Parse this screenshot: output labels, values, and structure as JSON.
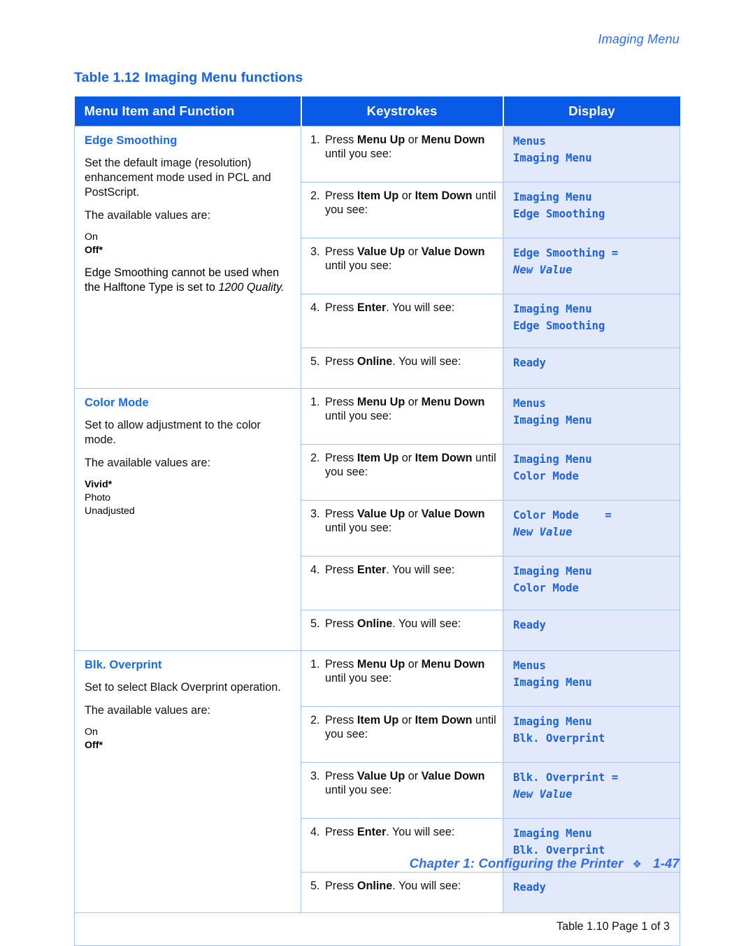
{
  "running_head": "Imaging Menu",
  "table_caption": {
    "label": "Table 1.12",
    "title": "Imaging Menu functions"
  },
  "columns": {
    "function": "Menu Item and Function",
    "keystrokes": "Keystrokes",
    "display": "Display"
  },
  "sections": [
    {
      "title": "Edge Smoothing",
      "description_1": "Set the default image (resolution) enhancement mode used in PCL and PostScript.",
      "description_2": "The available values are:",
      "values": [
        {
          "text": "On",
          "default": false
        },
        {
          "text": "Off*",
          "default": true
        }
      ],
      "note_plain": "Edge Smoothing cannot be used when the Halftone Type is set to ",
      "note_italic": "1200 Quality.",
      "steps": [
        {
          "number": "1.",
          "text_parts": [
            "Press ",
            "Menu Up",
            " or ",
            "Menu Down",
            " until you see:"
          ],
          "display_line_1": "Menus",
          "display_line_2": "Imaging Menu",
          "display_line_2_italic": false
        },
        {
          "number": "2.",
          "text_parts": [
            "Press ",
            "Item Up",
            " or ",
            "Item Down",
            " until you see:"
          ],
          "display_line_1": "Imaging Menu",
          "display_line_2": "Edge Smoothing",
          "display_line_2_italic": false
        },
        {
          "number": "3.",
          "text_parts": [
            "Press ",
            "Value Up",
            " or ",
            "Value Down",
            " until you see:"
          ],
          "display_line_1": "Edge Smoothing =",
          "display_line_2": "New Value",
          "display_line_2_italic": true
        },
        {
          "number": "4.",
          "text_parts": [
            "Press ",
            "Enter",
            ". You will see:",
            "",
            ""
          ],
          "display_line_1": "Imaging Menu",
          "display_line_2": "Edge Smoothing",
          "display_line_2_italic": false
        },
        {
          "number": "5.",
          "text_parts": [
            "Press ",
            "Online",
            ". You will see:",
            "",
            ""
          ],
          "display_line_1": "Ready",
          "display_line_2": "",
          "display_line_2_italic": false
        }
      ]
    },
    {
      "title": "Color Mode",
      "description_1": "Set to allow adjustment to the color mode.",
      "description_2": "The available values are:",
      "values": [
        {
          "text": "Vivid*",
          "default": true
        },
        {
          "text": "Photo",
          "default": false
        },
        {
          "text": "Unadjusted",
          "default": false
        }
      ],
      "note_plain": "",
      "note_italic": "",
      "steps": [
        {
          "number": "1.",
          "text_parts": [
            "Press ",
            "Menu Up",
            " or ",
            "Menu Down",
            " until you see:"
          ],
          "display_line_1": "Menus",
          "display_line_2": "Imaging Menu",
          "display_line_2_italic": false
        },
        {
          "number": "2.",
          "text_parts": [
            "Press ",
            "Item Up",
            " or ",
            "Item Down",
            " until you see:"
          ],
          "display_line_1": "Imaging Menu",
          "display_line_2": "Color Mode",
          "display_line_2_italic": false
        },
        {
          "number": "3.",
          "text_parts": [
            "Press ",
            "Value Up",
            " or ",
            "Value Down",
            " until you see:"
          ],
          "display_line_1": "Color Mode    =",
          "display_line_2": "New Value",
          "display_line_2_italic": true
        },
        {
          "number": "4.",
          "text_parts": [
            "Press ",
            "Enter",
            ". You will see:",
            "",
            ""
          ],
          "display_line_1": "Imaging Menu",
          "display_line_2": "Color Mode",
          "display_line_2_italic": false
        },
        {
          "number": "5.",
          "text_parts": [
            "Press ",
            "Online",
            ". You will see:",
            "",
            ""
          ],
          "display_line_1": "Ready",
          "display_line_2": "",
          "display_line_2_italic": false
        }
      ]
    },
    {
      "title": "Blk. Overprint",
      "description_1": "Set to select Black Overprint operation.",
      "description_2": "The available values are:",
      "values": [
        {
          "text": "On",
          "default": false
        },
        {
          "text": "Off*",
          "default": true
        }
      ],
      "note_plain": "",
      "note_italic": "",
      "steps": [
        {
          "number": "1.",
          "text_parts": [
            "Press ",
            "Menu Up",
            " or ",
            "Menu Down",
            " until you see:"
          ],
          "display_line_1": "Menus",
          "display_line_2": "Imaging Menu",
          "display_line_2_italic": false
        },
        {
          "number": "2.",
          "text_parts": [
            "Press ",
            "Item Up",
            " or ",
            "Item Down",
            " until you see:"
          ],
          "display_line_1": "Imaging Menu",
          "display_line_2": "Blk. Overprint",
          "display_line_2_italic": false
        },
        {
          "number": "3.",
          "text_parts": [
            "Press ",
            "Value Up",
            " or ",
            "Value Down",
            " until you see:"
          ],
          "display_line_1": "Blk. Overprint =",
          "display_line_2": "New Value",
          "display_line_2_italic": true
        },
        {
          "number": "4.",
          "text_parts": [
            "Press ",
            "Enter",
            ". You will see:",
            "",
            ""
          ],
          "display_line_1": "Imaging Menu",
          "display_line_2": "Blk. Overprint",
          "display_line_2_italic": false
        },
        {
          "number": "5.",
          "text_parts": [
            "Press ",
            "Online",
            ". You will see:",
            "",
            ""
          ],
          "display_line_1": "Ready",
          "display_line_2": "",
          "display_line_2_italic": false
        }
      ]
    }
  ],
  "table_footer": "Table 1.10  Page 1 of 3",
  "page_footer": {
    "chapter": "Chapter 1: Configuring the Printer",
    "ornament": "❖",
    "page_number": "1-47"
  },
  "colors": {
    "header_blue": "#0a5ae8",
    "accent_blue": "#1663e8",
    "display_bg": "#e2e9fa",
    "display_text": "#1e62e0",
    "border": "#aac4ef"
  }
}
